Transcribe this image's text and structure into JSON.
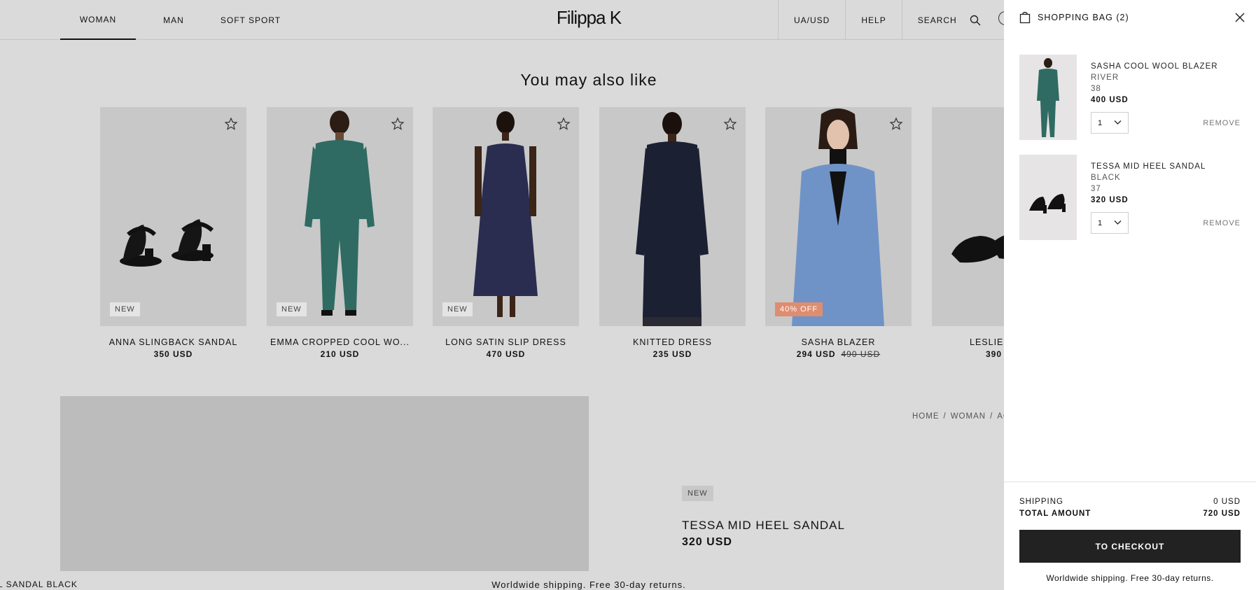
{
  "header": {
    "nav": [
      "WOMAN",
      "MAN",
      "SOFT SPORT"
    ],
    "logo": "Filippa K",
    "currency": "UA/USD",
    "help": "HELP",
    "search": "SEARCH",
    "icons": [
      "search-icon",
      "account-icon"
    ]
  },
  "recommendations": {
    "title": "You may also like",
    "items": [
      {
        "name": "ANNA SLINGBACK SANDAL",
        "price": "350 USD",
        "badge": "NEW"
      },
      {
        "name": "EMMA CROPPED COOL WO...",
        "price": "210 USD",
        "badge": "NEW"
      },
      {
        "name": "LONG SATIN SLIP DRESS",
        "price": "470 USD",
        "badge": "NEW"
      },
      {
        "name": "KNITTED DRESS",
        "price": "235 USD",
        "badge": ""
      },
      {
        "name": "SASHA BLAZER",
        "price": "294 USD",
        "old_price": "490 USD",
        "badge": "40% OFF"
      },
      {
        "name": "LESLIE",
        "price": "390",
        "badge": ""
      }
    ]
  },
  "product": {
    "breadcrumb": [
      "HOME",
      "WOMAN",
      "AC"
    ],
    "badge": "NEW",
    "name": "TESSA MID HEEL SANDAL",
    "price": "320 USD"
  },
  "ticker": "EL SANDAL BLACK",
  "footer_note": "Worldwide shipping. Free 30-day returns.",
  "cart": {
    "title": "SHOPPING BAG (2)",
    "items": [
      {
        "name": "SASHA COOL WOOL BLAZER",
        "color": "RIVER",
        "size": "38",
        "price": "400 USD",
        "qty": "1",
        "remove": "REMOVE"
      },
      {
        "name": "TESSA MID HEEL SANDAL",
        "color": "BLACK",
        "size": "37",
        "price": "320 USD",
        "qty": "1",
        "remove": "REMOVE"
      }
    ],
    "shipping_label": "SHIPPING",
    "shipping_value": "0 USD",
    "total_label": "TOTAL AMOUNT",
    "total_value": "720 USD",
    "checkout": "TO CHECKOUT",
    "note": "Worldwide shipping. Free 30-day returns."
  },
  "colors": {
    "page_bg": "#dadada",
    "drawer_bg": "#ffffff",
    "checkout_bg": "#222222",
    "sale_badge": "#de8d70"
  }
}
